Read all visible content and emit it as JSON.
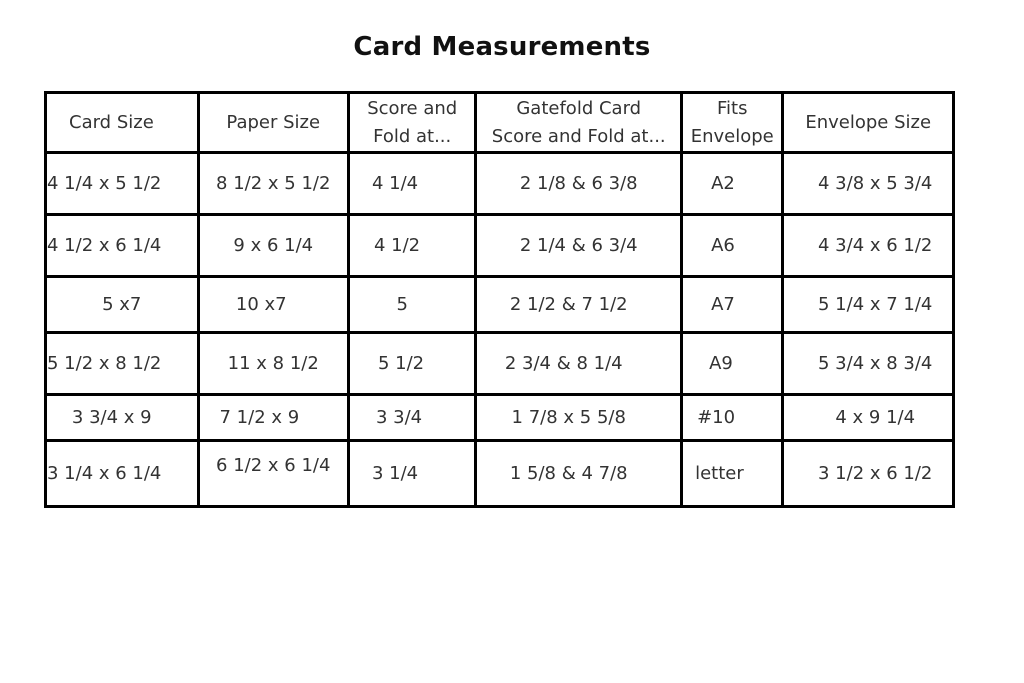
{
  "title": "Card Measurements",
  "table": {
    "headers": [
      "Card Size",
      "Paper Size",
      "Score and Fold at...",
      "Gatefold Card Score and Fold at...",
      "Fits Envelope",
      "Envelope Size"
    ],
    "header_lines": {
      "score": [
        "Score and",
        "Fold at..."
      ],
      "gatefold": [
        "Gatefold Card",
        "Score and Fold at..."
      ],
      "fits": [
        "Fits",
        "Envelope"
      ]
    },
    "rows": [
      [
        "4 1/4 x 5 1/2",
        "8 1/2 x 5 1/2",
        "4 1/4",
        "2 1/8 & 6 3/8",
        "A2",
        "4 3/8 x 5 3/4"
      ],
      [
        "4 1/2 x 6 1/4",
        "9 x 6 1/4",
        "4 1/2",
        "2 1/4 & 6 3/4",
        "A6",
        "4 3/4 x 6 1/2"
      ],
      [
        "5 x7",
        "10 x7",
        "5",
        "2 1/2 & 7 1/2",
        "A7",
        "5 1/4 x 7 1/4"
      ],
      [
        "5 1/2 x 8 1/2",
        "11 x 8 1/2",
        "5 1/2",
        "2 3/4 & 8 1/4",
        "A9",
        "5 3/4 x 8 3/4"
      ],
      [
        "3 3/4 x 9",
        "7 1/2 x 9",
        "3 3/4",
        "1 7/8 x 5 5/8",
        "#10",
        "4 x 9 1/4"
      ],
      [
        "3 1/4 x 6 1/4",
        "6 1/2 x 6 1/4",
        "3 1/4",
        "1 5/8 & 4 7/8",
        "letter",
        "3 1/2 x 6 1/2"
      ]
    ]
  }
}
